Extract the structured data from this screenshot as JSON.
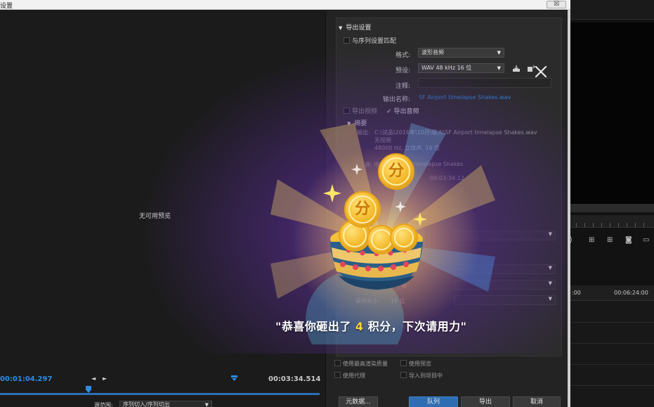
{
  "window": {
    "title": "设置",
    "close_glyph": "☒"
  },
  "preview": {
    "no_preview": "无可用预览",
    "timecode_current": "00:01:04.297",
    "timecode_end": "00:03:34.514",
    "marker_in": "◄",
    "marker_out": "►",
    "source_range_label": "源范围:",
    "source_range_value": "序列切入/序列切出"
  },
  "export_settings": {
    "section_title": "导出设置",
    "match_sequence": "与序列设置匹配",
    "format_label": "格式:",
    "format_value": "波形音频",
    "preset_label": "预设:",
    "preset_value": "WAV 48 kHz 16 位",
    "notes_label": "注释:",
    "output_name_label": "输出名称:",
    "output_name_value": "SF Airport timelapse Shakes.wav",
    "export_video": "导出视频",
    "export_audio": "导出音频",
    "export_audio_checked": true,
    "summary_title": "摘要",
    "summary_output_label": "输出:",
    "summary_output_path": "C:\\试品\\2016年\\10月\\版大\\SF Airport timelapse Shakes.wav",
    "summary_no_video": "无视频",
    "summary_audio_line": "48000 Hz, 立体声, 16 位",
    "summary_source_label": "源: 序",
    "summary_source_value": "timelapse Shakes",
    "summary_source_time": "00:03:34:12",
    "lower_label_1": "音",
    "lower_label_2": "采样大小:",
    "lower_value_2": "16 位",
    "use_max_render": "使用最高渲染质量",
    "use_preview": "使用预览",
    "use_proxy": "使用代理",
    "import_into_project": "导入到项目中"
  },
  "buttons": {
    "metadata": "元数据...",
    "queue": "队列",
    "export": "导出",
    "cancel": "取消"
  },
  "background_app": {
    "timeline_time_1": ":00",
    "timeline_time_2": "00:06:24:00"
  },
  "reward_overlay": {
    "message_prefix": "\"恭喜你砸出了 ",
    "points": "4",
    "message_suffix": " 积分，下次请用力\"",
    "coin_label": "分",
    "close_glyph": "✕"
  },
  "colors": {
    "accent_blue": "#2d8ce6",
    "link_blue": "#2d7fd3",
    "overlay_purple": "#763cbe",
    "gold": "#f4b92a",
    "points_yellow": "#ffd33c"
  }
}
